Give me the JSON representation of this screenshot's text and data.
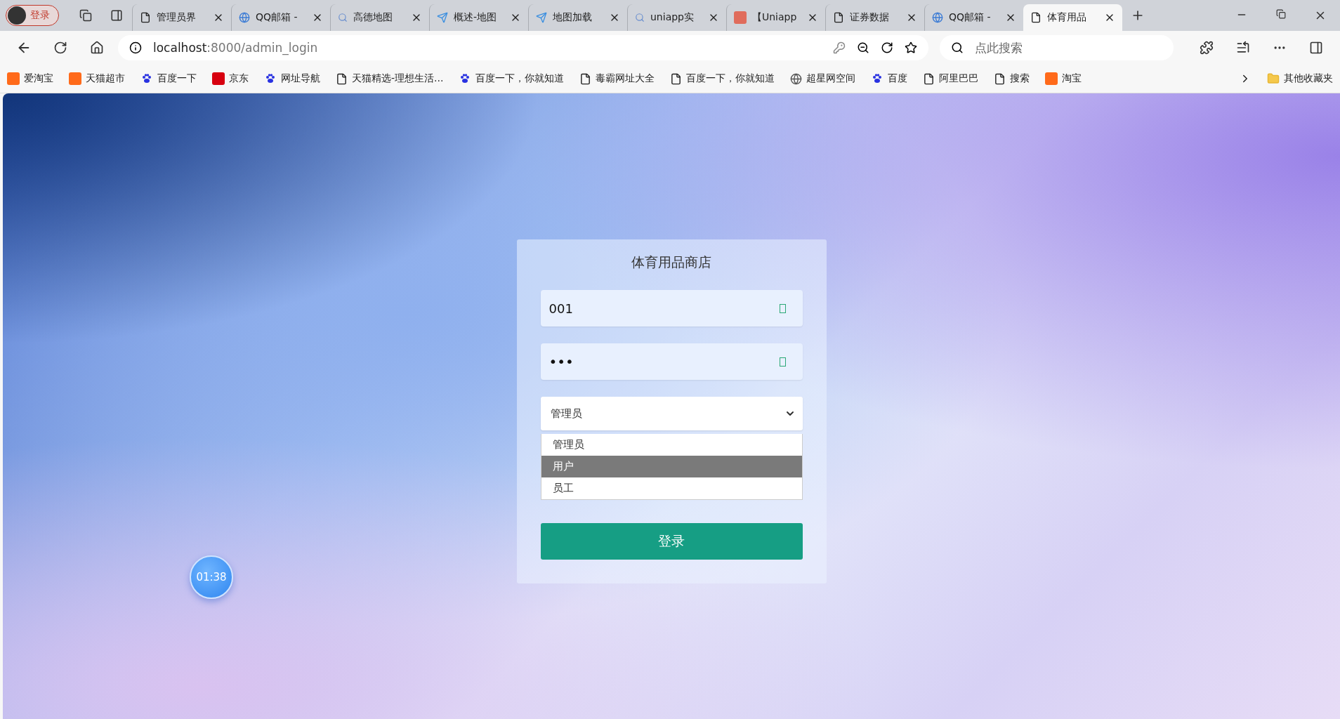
{
  "browser": {
    "profile_button": "登录",
    "tabs": [
      {
        "kind": "page",
        "title": "管理员界",
        "selected": false
      },
      {
        "kind": "globe",
        "title": "QQ邮箱 -",
        "selected": false
      },
      {
        "kind": "search",
        "title": "高德地图",
        "selected": false
      },
      {
        "kind": "plane",
        "title": "概述-地图",
        "selected": false
      },
      {
        "kind": "plane",
        "title": "地图加载",
        "selected": false
      },
      {
        "kind": "search",
        "title": "uniapp实",
        "selected": false
      },
      {
        "kind": "logo",
        "title": "【Uniapp",
        "selected": false
      },
      {
        "kind": "page",
        "title": "证券数据",
        "selected": false
      },
      {
        "kind": "globe",
        "title": "QQ邮箱 -",
        "selected": false
      },
      {
        "kind": "page",
        "title": "体育用品",
        "selected": true
      }
    ],
    "address": {
      "host": "localhost",
      "rest": ":8000/admin_login"
    },
    "search": {
      "placeholder": "点此搜索"
    },
    "bookmarks": [
      {
        "kind": "tao",
        "label": "爱淘宝"
      },
      {
        "kind": "tao",
        "label": "天猫超市"
      },
      {
        "kind": "paw",
        "label": "百度一下"
      },
      {
        "kind": "jd",
        "label": "京东"
      },
      {
        "kind": "paw",
        "label": "网址导航"
      },
      {
        "kind": "page",
        "label": "天猫精选-理想生活..."
      },
      {
        "kind": "paw",
        "label": "百度一下，你就知道"
      },
      {
        "kind": "page",
        "label": "毒霸网址大全"
      },
      {
        "kind": "page",
        "label": "百度一下，你就知道"
      },
      {
        "kind": "globe",
        "label": "超星网空间"
      },
      {
        "kind": "paw",
        "label": "百度"
      },
      {
        "kind": "page",
        "label": "阿里巴巴"
      },
      {
        "kind": "page",
        "label": "搜索"
      },
      {
        "kind": "tao",
        "label": "淘宝"
      }
    ],
    "other_bookmarks": "其他收藏夹"
  },
  "login": {
    "title": "体育用品商店",
    "username": "001",
    "password": "•••",
    "role": "管理员",
    "options": [
      {
        "label": "管理员",
        "selected": false
      },
      {
        "label": "用户",
        "selected": true
      },
      {
        "label": "员工",
        "selected": false
      }
    ],
    "button": "登录"
  },
  "timer": "01:38"
}
